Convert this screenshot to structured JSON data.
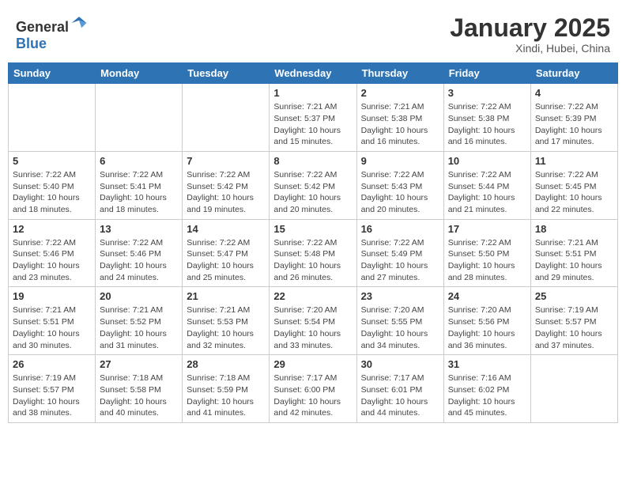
{
  "header": {
    "logo_general": "General",
    "logo_blue": "Blue",
    "month_title": "January 2025",
    "subtitle": "Xindi, Hubei, China"
  },
  "days_of_week": [
    "Sunday",
    "Monday",
    "Tuesday",
    "Wednesday",
    "Thursday",
    "Friday",
    "Saturday"
  ],
  "weeks": [
    [
      {
        "day": "",
        "info": ""
      },
      {
        "day": "",
        "info": ""
      },
      {
        "day": "",
        "info": ""
      },
      {
        "day": "1",
        "info": "Sunrise: 7:21 AM\nSunset: 5:37 PM\nDaylight: 10 hours\nand 15 minutes."
      },
      {
        "day": "2",
        "info": "Sunrise: 7:21 AM\nSunset: 5:38 PM\nDaylight: 10 hours\nand 16 minutes."
      },
      {
        "day": "3",
        "info": "Sunrise: 7:22 AM\nSunset: 5:38 PM\nDaylight: 10 hours\nand 16 minutes."
      },
      {
        "day": "4",
        "info": "Sunrise: 7:22 AM\nSunset: 5:39 PM\nDaylight: 10 hours\nand 17 minutes."
      }
    ],
    [
      {
        "day": "5",
        "info": "Sunrise: 7:22 AM\nSunset: 5:40 PM\nDaylight: 10 hours\nand 18 minutes."
      },
      {
        "day": "6",
        "info": "Sunrise: 7:22 AM\nSunset: 5:41 PM\nDaylight: 10 hours\nand 18 minutes."
      },
      {
        "day": "7",
        "info": "Sunrise: 7:22 AM\nSunset: 5:42 PM\nDaylight: 10 hours\nand 19 minutes."
      },
      {
        "day": "8",
        "info": "Sunrise: 7:22 AM\nSunset: 5:42 PM\nDaylight: 10 hours\nand 20 minutes."
      },
      {
        "day": "9",
        "info": "Sunrise: 7:22 AM\nSunset: 5:43 PM\nDaylight: 10 hours\nand 20 minutes."
      },
      {
        "day": "10",
        "info": "Sunrise: 7:22 AM\nSunset: 5:44 PM\nDaylight: 10 hours\nand 21 minutes."
      },
      {
        "day": "11",
        "info": "Sunrise: 7:22 AM\nSunset: 5:45 PM\nDaylight: 10 hours\nand 22 minutes."
      }
    ],
    [
      {
        "day": "12",
        "info": "Sunrise: 7:22 AM\nSunset: 5:46 PM\nDaylight: 10 hours\nand 23 minutes."
      },
      {
        "day": "13",
        "info": "Sunrise: 7:22 AM\nSunset: 5:46 PM\nDaylight: 10 hours\nand 24 minutes."
      },
      {
        "day": "14",
        "info": "Sunrise: 7:22 AM\nSunset: 5:47 PM\nDaylight: 10 hours\nand 25 minutes."
      },
      {
        "day": "15",
        "info": "Sunrise: 7:22 AM\nSunset: 5:48 PM\nDaylight: 10 hours\nand 26 minutes."
      },
      {
        "day": "16",
        "info": "Sunrise: 7:22 AM\nSunset: 5:49 PM\nDaylight: 10 hours\nand 27 minutes."
      },
      {
        "day": "17",
        "info": "Sunrise: 7:22 AM\nSunset: 5:50 PM\nDaylight: 10 hours\nand 28 minutes."
      },
      {
        "day": "18",
        "info": "Sunrise: 7:21 AM\nSunset: 5:51 PM\nDaylight: 10 hours\nand 29 minutes."
      }
    ],
    [
      {
        "day": "19",
        "info": "Sunrise: 7:21 AM\nSunset: 5:51 PM\nDaylight: 10 hours\nand 30 minutes."
      },
      {
        "day": "20",
        "info": "Sunrise: 7:21 AM\nSunset: 5:52 PM\nDaylight: 10 hours\nand 31 minutes."
      },
      {
        "day": "21",
        "info": "Sunrise: 7:21 AM\nSunset: 5:53 PM\nDaylight: 10 hours\nand 32 minutes."
      },
      {
        "day": "22",
        "info": "Sunrise: 7:20 AM\nSunset: 5:54 PM\nDaylight: 10 hours\nand 33 minutes."
      },
      {
        "day": "23",
        "info": "Sunrise: 7:20 AM\nSunset: 5:55 PM\nDaylight: 10 hours\nand 34 minutes."
      },
      {
        "day": "24",
        "info": "Sunrise: 7:20 AM\nSunset: 5:56 PM\nDaylight: 10 hours\nand 36 minutes."
      },
      {
        "day": "25",
        "info": "Sunrise: 7:19 AM\nSunset: 5:57 PM\nDaylight: 10 hours\nand 37 minutes."
      }
    ],
    [
      {
        "day": "26",
        "info": "Sunrise: 7:19 AM\nSunset: 5:57 PM\nDaylight: 10 hours\nand 38 minutes."
      },
      {
        "day": "27",
        "info": "Sunrise: 7:18 AM\nSunset: 5:58 PM\nDaylight: 10 hours\nand 40 minutes."
      },
      {
        "day": "28",
        "info": "Sunrise: 7:18 AM\nSunset: 5:59 PM\nDaylight: 10 hours\nand 41 minutes."
      },
      {
        "day": "29",
        "info": "Sunrise: 7:17 AM\nSunset: 6:00 PM\nDaylight: 10 hours\nand 42 minutes."
      },
      {
        "day": "30",
        "info": "Sunrise: 7:17 AM\nSunset: 6:01 PM\nDaylight: 10 hours\nand 44 minutes."
      },
      {
        "day": "31",
        "info": "Sunrise: 7:16 AM\nSunset: 6:02 PM\nDaylight: 10 hours\nand 45 minutes."
      },
      {
        "day": "",
        "info": ""
      }
    ]
  ]
}
